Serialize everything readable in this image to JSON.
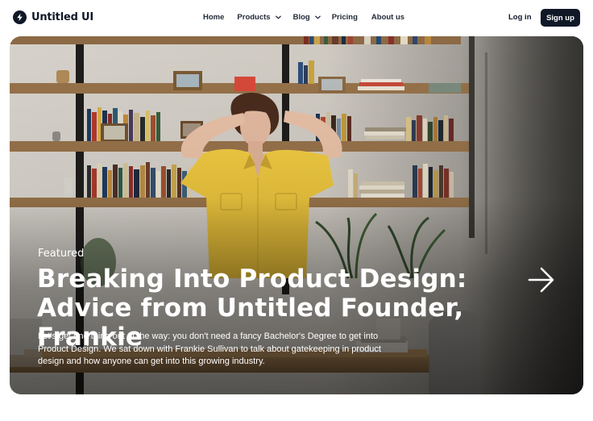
{
  "brand": {
    "name": "Untitled UI",
    "logo_icon": "bolt-icon"
  },
  "nav": {
    "items": [
      {
        "label": "Home"
      },
      {
        "label": "Products",
        "icon": "chevron-down-icon"
      },
      {
        "label": "Blog",
        "icon": "chevron-down-icon"
      },
      {
        "label": "Pricing"
      },
      {
        "label": "About us"
      }
    ]
  },
  "auth": {
    "login_label": "Log in",
    "signup_label": "Sign up"
  },
  "hero": {
    "tag": "Featured",
    "title_line1": "Breaking Into Product Design:",
    "title_line2": "Advice from Untitled Founder, Frankie",
    "description": "Let's get one thing out of the way: you don't need a fancy Bachelor's Degree to get into Product Design. We sat down with Frankie Sullivan to talk about gatekeeping in product design and how anyone can get into this growing industry.",
    "arrow_icon": "arrow-right-icon"
  },
  "colors": {
    "primary": "#101828",
    "shirt": "#e9c33f",
    "text_on_image": "#ffffff"
  }
}
